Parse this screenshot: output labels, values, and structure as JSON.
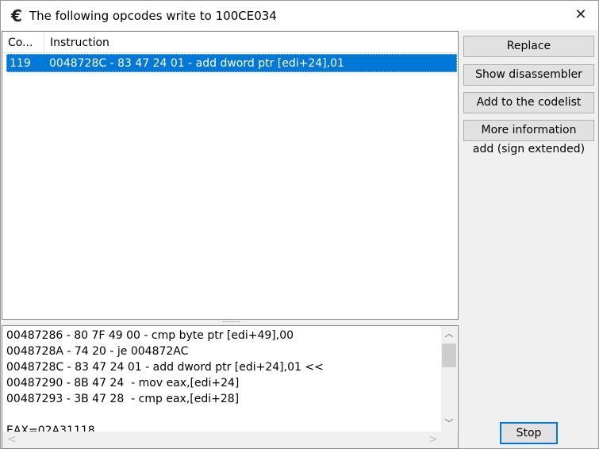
{
  "window": {
    "title": "The following opcodes write to 100CE034",
    "icon": "cheat-engine-logo",
    "close_icon": "close-icon"
  },
  "list": {
    "columns": [
      "Co...",
      "Instruction"
    ],
    "rows": [
      {
        "count": "119",
        "instruction": "0048728C - 83 47 24 01 - add dword ptr [edi+24],01",
        "selected": true
      }
    ]
  },
  "buttons": {
    "replace": "Replace",
    "show_disassembler": "Show disassembler",
    "add_codelist": "Add to the codelist",
    "more_info": "More information",
    "stop": "Stop"
  },
  "info_label": "add (sign extended)",
  "details": {
    "lines": [
      "00487286 - 80 7F 49 00 - cmp byte ptr [edi+49],00",
      "0048728A - 74 20 - je 004872AC",
      "0048728C - 83 47 24 01 - add dword ptr [edi+24],01 <<",
      "00487290 - 8B 47 24  - mov eax,[edi+24]",
      "00487293 - 3B 47 28  - cmp eax,[edi+28]",
      "",
      "EAX=02A31118"
    ]
  },
  "colors": {
    "selection": "#0078d7",
    "focus_border": "#0078d7"
  }
}
